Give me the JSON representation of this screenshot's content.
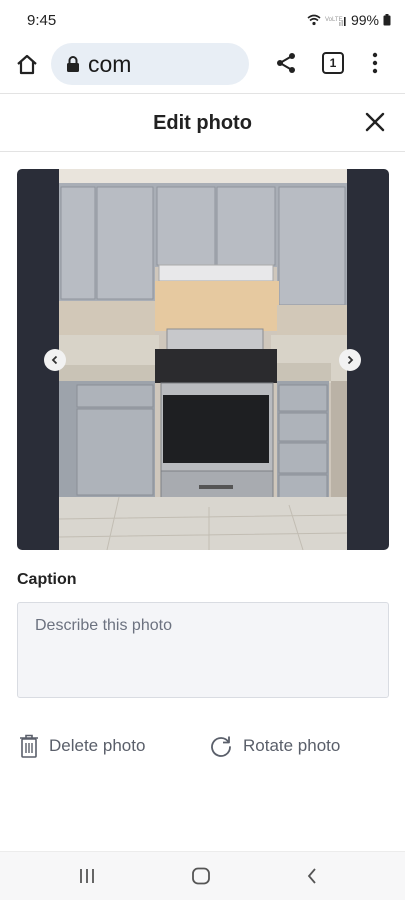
{
  "status_bar": {
    "time": "9:45",
    "battery": "99%"
  },
  "browser": {
    "url": "com",
    "tab_count": "1"
  },
  "header": {
    "title": "Edit photo"
  },
  "caption": {
    "label": "Caption",
    "placeholder": "Describe this photo",
    "value": ""
  },
  "actions": {
    "delete_label": "Delete photo",
    "rotate_label": "Rotate photo"
  },
  "icons": {
    "home": "home-icon",
    "lock": "lock-icon",
    "share": "share-icon",
    "tabs": "tabs-icon",
    "menu": "more-vert-icon",
    "close": "close-icon",
    "prev": "chevron-left-icon",
    "next": "chevron-right-icon",
    "delete": "trash-icon",
    "rotate": "rotate-icon",
    "recents": "recents-icon",
    "nav_home": "nav-home-icon",
    "back": "back-icon"
  },
  "colors": {
    "photo_frame": "#2a2d38",
    "url_pill": "#e8eef5",
    "caption_bg": "#f4f5f8",
    "action_text": "#5a5f6a"
  }
}
